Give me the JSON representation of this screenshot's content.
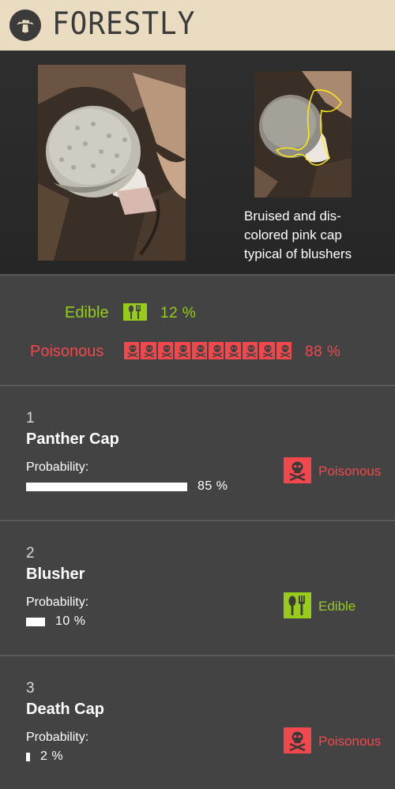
{
  "app": {
    "title": "FORESTLY",
    "logo_icon": "mushroom-logo-icon"
  },
  "photos": {
    "caption": "Bruised and dis-colored pink cap typical of blushers",
    "caption_lines": [
      "Bruised and dis-",
      "colored pink cap",
      "typical of blushers"
    ]
  },
  "summary": {
    "edible_label": "Edible",
    "edible_pct": "12 %",
    "poisonous_label": "Poisonous",
    "poisonous_pct": "88 %",
    "edible_icon": "fork-spoon-icon",
    "poisonous_icon": "skull-crossbones-icon",
    "edible_fraction": 0.12,
    "poisonous_fraction": 0.88
  },
  "results": [
    {
      "rank": "1",
      "name": "Panther Cap",
      "prob_label": "Probability:",
      "prob_pct": "85 %",
      "probability": 0.85,
      "toxicity": "Poisonous",
      "toxicity_icon": "skull-crossbones-icon"
    },
    {
      "rank": "2",
      "name": "Blusher",
      "prob_label": "Probability:",
      "prob_pct": "10 %",
      "probability": 0.1,
      "toxicity": "Edible",
      "toxicity_icon": "fork-spoon-icon"
    },
    {
      "rank": "3",
      "name": "Death Cap",
      "prob_label": "Probability:",
      "prob_pct": "2 %",
      "probability": 0.02,
      "toxicity": "Poisonous",
      "toxicity_icon": "skull-crossbones-icon"
    }
  ],
  "colors": {
    "header_bg": "#e9dcc1",
    "edible": "#97cc1b",
    "poisonous": "#f2474c",
    "panel_bg": "#434343"
  }
}
